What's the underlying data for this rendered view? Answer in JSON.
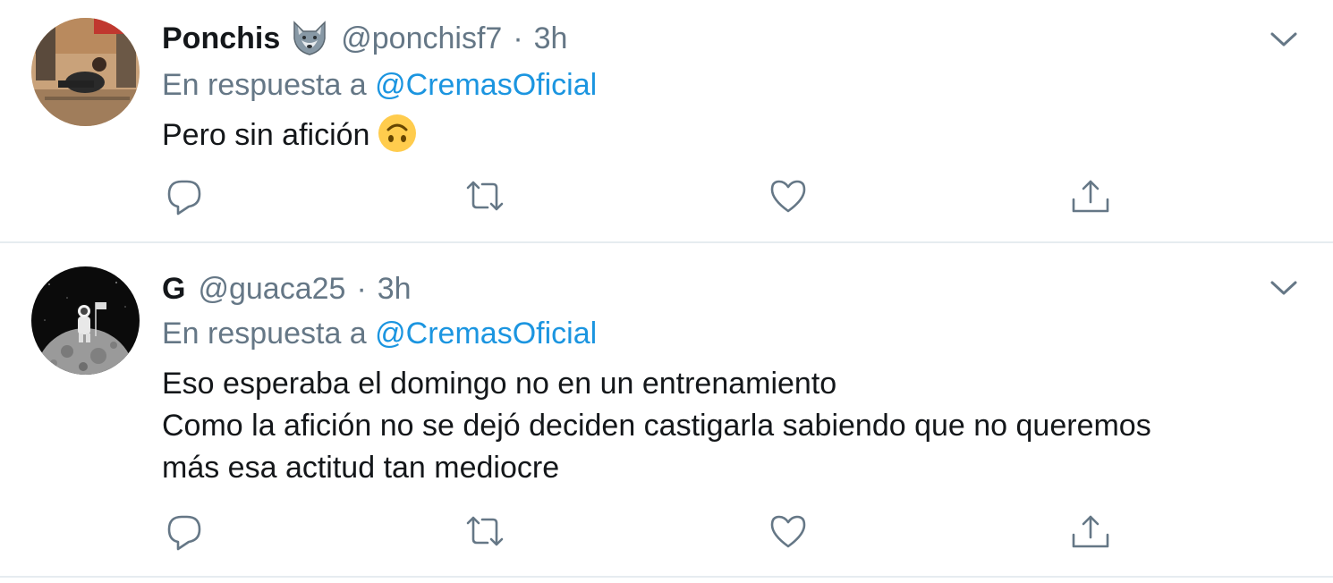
{
  "tweets": [
    {
      "display_name": "Ponchis",
      "name_emoji": "wolf-emoji",
      "handle": "@ponchisf7",
      "separator": "·",
      "time": "3h",
      "reply_prefix": "En respuesta a",
      "reply_to": "@CremasOficial",
      "text_lines": [
        "Pero sin afición"
      ],
      "text_emoji": "upside-down-face-emoji",
      "avatar": "photo-avatar"
    },
    {
      "display_name": "G",
      "handle": "@guaca25",
      "separator": "·",
      "time": "3h",
      "reply_prefix": "En respuesta a",
      "reply_to": "@CremasOficial",
      "text_lines": [
        "Eso esperaba el domingo no en un entrenamiento",
        "Como la afición no se dejó deciden castigarla sabiendo que no queremos",
        "más esa actitud tan mediocre"
      ],
      "avatar": "astronaut-on-moon-avatar"
    }
  ],
  "icons": {
    "reply": "reply-icon",
    "retweet": "retweet-icon",
    "like": "like-icon",
    "share": "share-icon",
    "more": "chevron-down-icon"
  },
  "colors": {
    "text": "#14171a",
    "secondary": "#657786",
    "link": "#1b95e0",
    "icon": "#657786",
    "divider": "#e6ecf0"
  }
}
